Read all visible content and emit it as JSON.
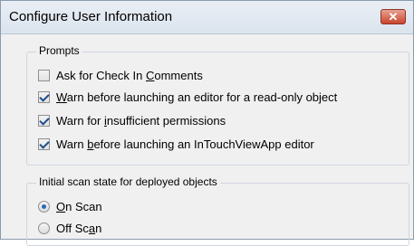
{
  "window": {
    "title": "Configure User Information"
  },
  "prompts": {
    "legend": "Prompts",
    "items": [
      {
        "pre": "Ask for Check In ",
        "u": "C",
        "post": "omments",
        "checked": false
      },
      {
        "pre": "",
        "u": "W",
        "post": "arn before launching an editor for a read-only object",
        "checked": true
      },
      {
        "pre": "Warn for ",
        "u": "i",
        "post": "nsufficient permissions",
        "checked": true
      },
      {
        "pre": "Warn ",
        "u": "b",
        "post": "efore launching an InTouchViewApp editor",
        "checked": true
      }
    ]
  },
  "scan": {
    "legend": "Initial scan state for deployed objects",
    "options": [
      {
        "pre": "",
        "u": "O",
        "post": "n Scan",
        "selected": true
      },
      {
        "pre": "Off Sc",
        "u": "a",
        "post": "n",
        "selected": false
      }
    ]
  }
}
